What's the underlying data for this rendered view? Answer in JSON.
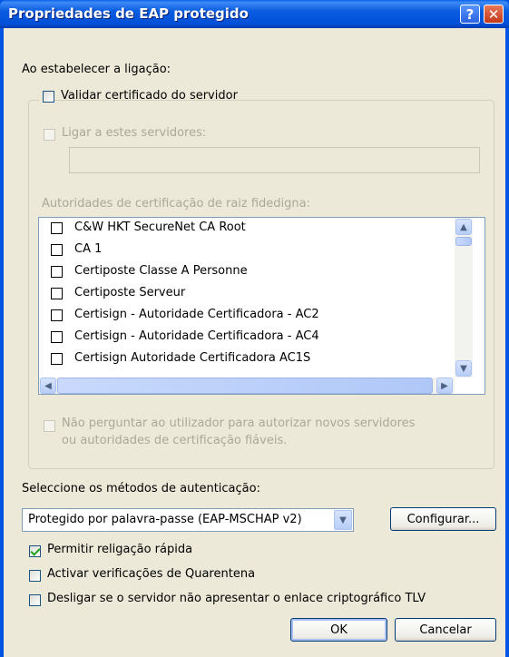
{
  "window": {
    "title": "Propriedades de EAP protegido",
    "help_glyph": "?",
    "close_glyph": "✕"
  },
  "connection": {
    "heading": "Ao estabelecer a ligação:",
    "validate_cert": {
      "label": "Validar certificado do servidor",
      "checked": false
    },
    "connect_servers": {
      "label": "Ligar a estes servidores:",
      "checked": false,
      "value": ""
    },
    "root_ca_label": "Autoridades de certificação de raiz fidedigna:",
    "ca_list": [
      "C&W HKT SecureNet CA Root",
      "CA 1",
      "Certiposte Classe A Personne",
      "Certiposte Serveur",
      "Certisign - Autoridade Certificadora - AC2",
      "Certisign - Autoridade Certificadora - AC4",
      "Certisign Autoridade Certificadora AC1S"
    ],
    "no_prompt": {
      "line1": "Não perguntar ao utilizador para autorizar novos servidores",
      "line2": "ou autoridades de certificação fiáveis.",
      "checked": false
    }
  },
  "auth": {
    "label": "Seleccione os métodos de autenticação:",
    "method": "Protegido por palavra-passe (EAP-MSCHAP v2)",
    "configure_label": "Configurar...",
    "fast_reconnect": {
      "label": "Permitir religação rápida",
      "checked": true
    },
    "quarantine": {
      "label": "Activar verificações de Quarentena",
      "checked": false
    },
    "tlv": {
      "label": "Desligar se o servidor não apresentar o enlace criptográfico TLV",
      "checked": false
    }
  },
  "buttons": {
    "ok": "OK",
    "cancel": "Cancelar"
  },
  "colors": {
    "titlebar": "#0054e3",
    "dialog_bg": "#ece9d8",
    "check_mark": "#21a121"
  }
}
